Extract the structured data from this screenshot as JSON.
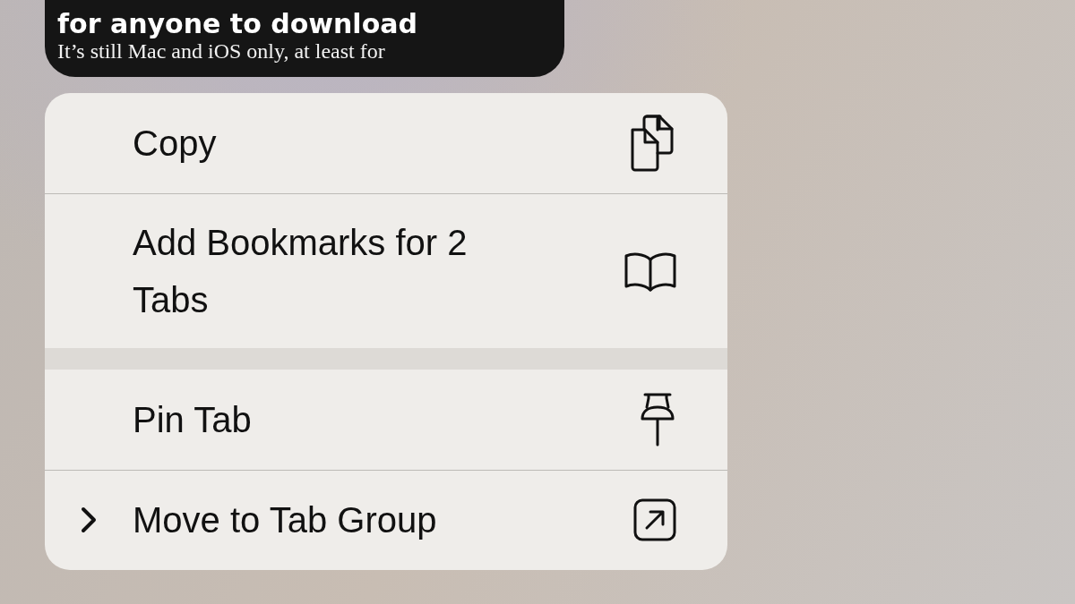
{
  "article_preview": {
    "headline": "for anyone to download",
    "subtitle": "It’s still Mac and iOS only, at least for"
  },
  "context_menu": {
    "groups": [
      {
        "items": [
          {
            "label": "Copy",
            "kind": "action"
          },
          {
            "label": "Add Bookmarks for 2 Tabs",
            "kind": "action"
          }
        ]
      },
      {
        "items": [
          {
            "label": "Pin Tab",
            "kind": "action"
          },
          {
            "label": "Move to Tab Group",
            "kind": "submenu"
          }
        ]
      }
    ]
  }
}
